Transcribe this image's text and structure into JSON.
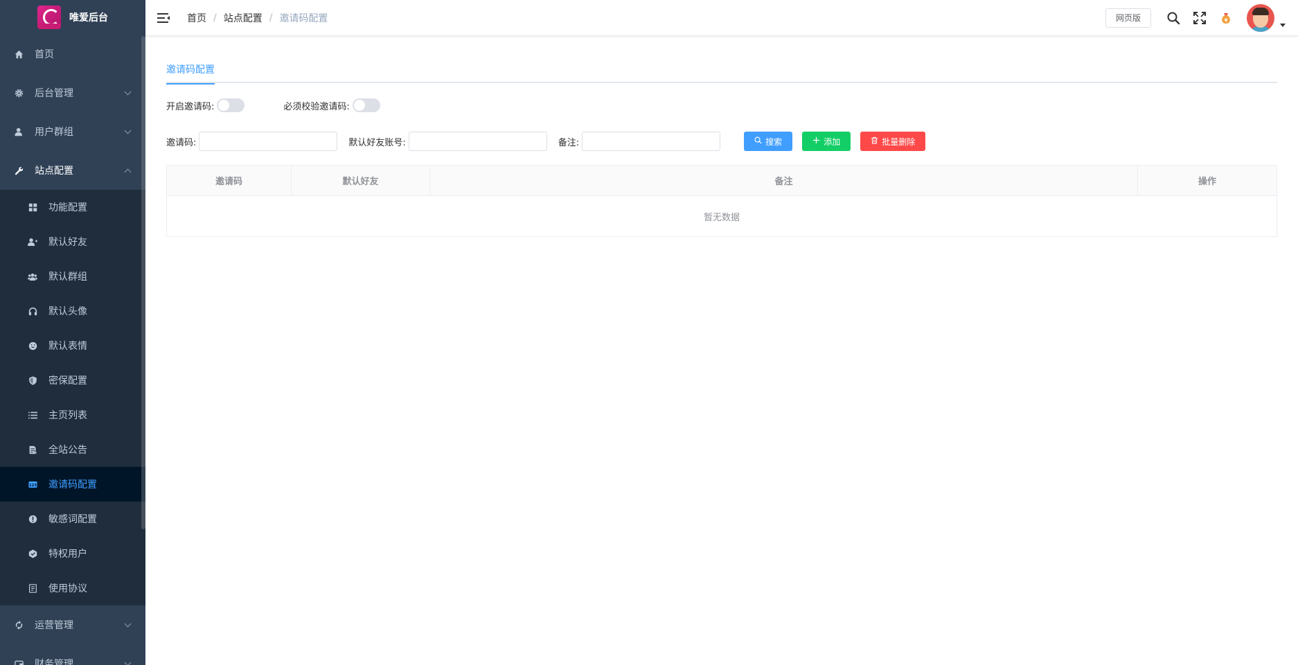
{
  "app": {
    "title": "唯爱后台"
  },
  "sidebar": {
    "items": [
      {
        "label": "首页",
        "icon": "home-icon"
      },
      {
        "label": "后台管理",
        "icon": "gear-icon"
      },
      {
        "label": "用户群组",
        "icon": "user-icon"
      },
      {
        "label": "站点配置",
        "icon": "wrench-icon"
      }
    ],
    "sub_items": [
      {
        "label": "功能配置",
        "icon": "grid-icon"
      },
      {
        "label": "默认好友",
        "icon": "user-plus-icon"
      },
      {
        "label": "默认群组",
        "icon": "users-icon"
      },
      {
        "label": "默认头像",
        "icon": "headphone-icon"
      },
      {
        "label": "默认表情",
        "icon": "smile-icon"
      },
      {
        "label": "密保配置",
        "icon": "shield-icon"
      },
      {
        "label": "主页列表",
        "icon": "list-icon"
      },
      {
        "label": "全站公告",
        "icon": "document-icon"
      },
      {
        "label": "邀请码配置",
        "icon": "code-icon"
      },
      {
        "label": "敏感词配置",
        "icon": "alert-icon"
      },
      {
        "label": "特权用户",
        "icon": "badge-icon"
      },
      {
        "label": "使用协议",
        "icon": "file-icon"
      }
    ],
    "after_items": [
      {
        "label": "运营管理",
        "icon": "operation-icon"
      },
      {
        "label": "财务管理",
        "icon": "wallet-icon"
      }
    ]
  },
  "header": {
    "breadcrumb": [
      "首页",
      "站点配置",
      "邀请码配置"
    ],
    "separator": "/",
    "web_button": "网页版"
  },
  "main": {
    "tab": "邀请码配置",
    "switches": [
      {
        "label": "开启邀请码:",
        "on": false
      },
      {
        "label": "必须校验邀请码:",
        "on": false
      }
    ],
    "filters": {
      "code_label": "邀请码:",
      "friend_label": "默认好友账号:",
      "remark_label": "备注:"
    },
    "buttons": {
      "search": "搜索",
      "add": "添加",
      "batch_delete": "批量删除"
    },
    "table": {
      "columns": [
        "邀请码",
        "默认好友",
        "备注",
        "操作"
      ],
      "empty_text": "暂无数据"
    }
  },
  "colors": {
    "sidebar_bg": "#304156",
    "submenu_bg": "#1f2d3d",
    "active_bg": "#001528",
    "primary": "#409eff",
    "success": "#13ce66",
    "danger": "#ff4949"
  }
}
